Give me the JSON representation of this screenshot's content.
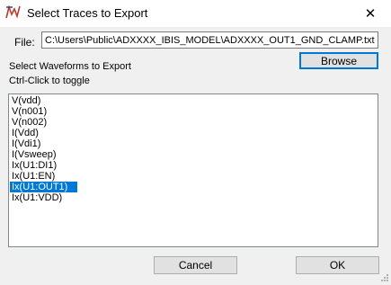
{
  "window": {
    "title": "Select Traces to Export",
    "app_icon": "ltspice-waveform-icon",
    "close_glyph": "✕"
  },
  "file": {
    "label": "File:",
    "value": "C:\\Users\\Public\\ADXXXX_IBIS_MODEL\\ADXXXX_OUT1_GND_CLAMP.txt"
  },
  "section_label": "Select Waveforms to Export",
  "hint": "Ctrl-Click to toggle",
  "browse_label": "Browse",
  "traces": {
    "items": [
      {
        "label": "V(vdd)",
        "selected": false
      },
      {
        "label": "V(n001)",
        "selected": false
      },
      {
        "label": "V(n002)",
        "selected": false
      },
      {
        "label": "I(Vdd)",
        "selected": false
      },
      {
        "label": "I(Vdi1)",
        "selected": false
      },
      {
        "label": "I(Vsweep)",
        "selected": false
      },
      {
        "label": "Ix(U1:DI1)",
        "selected": false
      },
      {
        "label": "Ix(U1:EN)",
        "selected": false
      },
      {
        "label": "Ix(U1:OUT1)",
        "selected": true
      },
      {
        "label": "Ix(U1:VDD)",
        "selected": false
      }
    ],
    "selection_color": "#0078d7"
  },
  "buttons": {
    "cancel_label": "Cancel",
    "ok_label": "OK"
  }
}
